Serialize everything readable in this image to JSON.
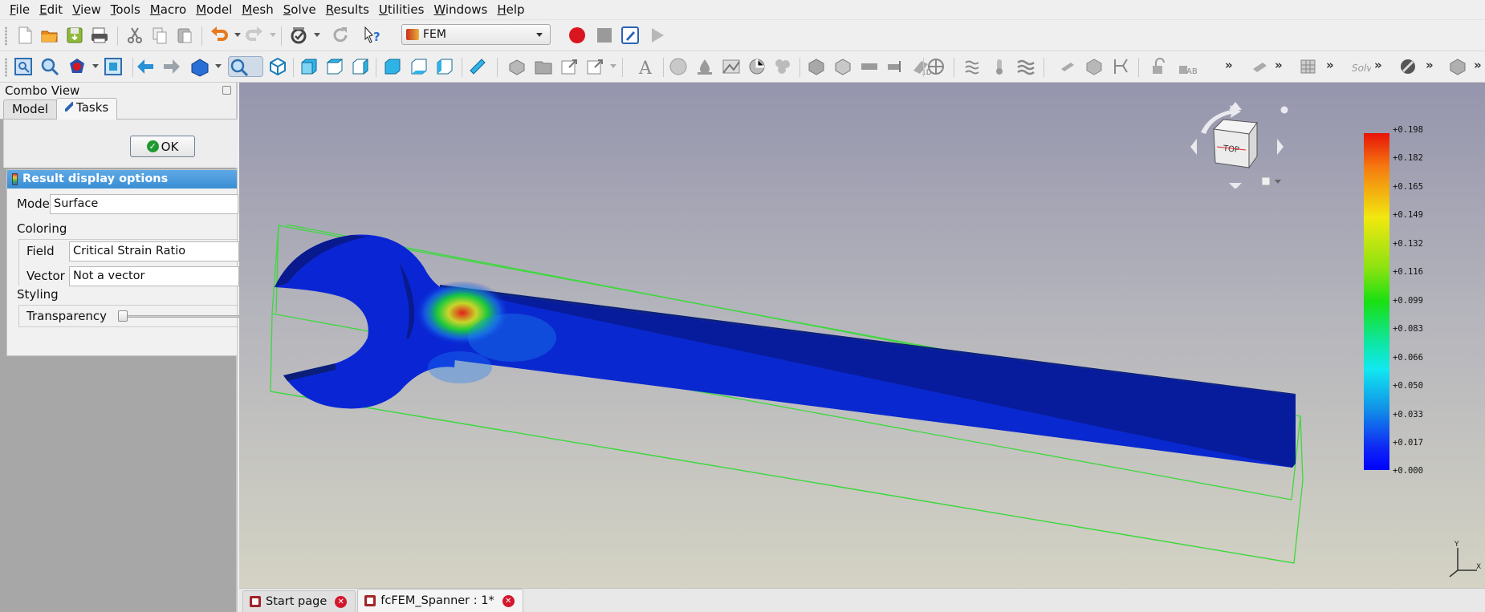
{
  "menu": [
    "File",
    "Edit",
    "View",
    "Tools",
    "Macro",
    "Model",
    "Mesh",
    "Solve",
    "Results",
    "Utilities",
    "Windows",
    "Help"
  ],
  "workbench": {
    "selected": "FEM"
  },
  "toolbar_more": "»",
  "combo_view": {
    "title": "Combo View",
    "tabs": [
      "Model",
      "Tasks"
    ],
    "active_tab": "Tasks",
    "ok_label": "OK"
  },
  "result_panel": {
    "header": "Result display options",
    "mode_label": "Mode",
    "mode_value": "Surface",
    "coloring_label": "Coloring",
    "field_label": "Field",
    "field_value": "Critical Strain Ratio",
    "vector_label": "Vector",
    "vector_value": "Not a vector",
    "styling_label": "Styling",
    "transparency_label": "Transparency",
    "transparency_value": 0
  },
  "legend": {
    "labels": [
      "+0.198",
      "+0.182",
      "+0.165",
      "+0.149",
      "+0.132",
      "+0.116",
      "+0.099",
      "+0.083",
      "+0.066",
      "+0.050",
      "+0.033",
      "+0.017",
      "+0.000"
    ]
  },
  "navcube": {
    "face_label": "TOP"
  },
  "axes": {
    "x": "X",
    "y": "Y"
  },
  "doc_tabs": [
    {
      "label": "Start page",
      "active": false
    },
    {
      "label": "fcFEM_Spanner : 1*",
      "active": true
    }
  ],
  "colors": {
    "accent_header": "#3a8ed4",
    "record": "#d9161f",
    "model_blue": "#0a2ddb",
    "bbox": "#3ed83e"
  }
}
